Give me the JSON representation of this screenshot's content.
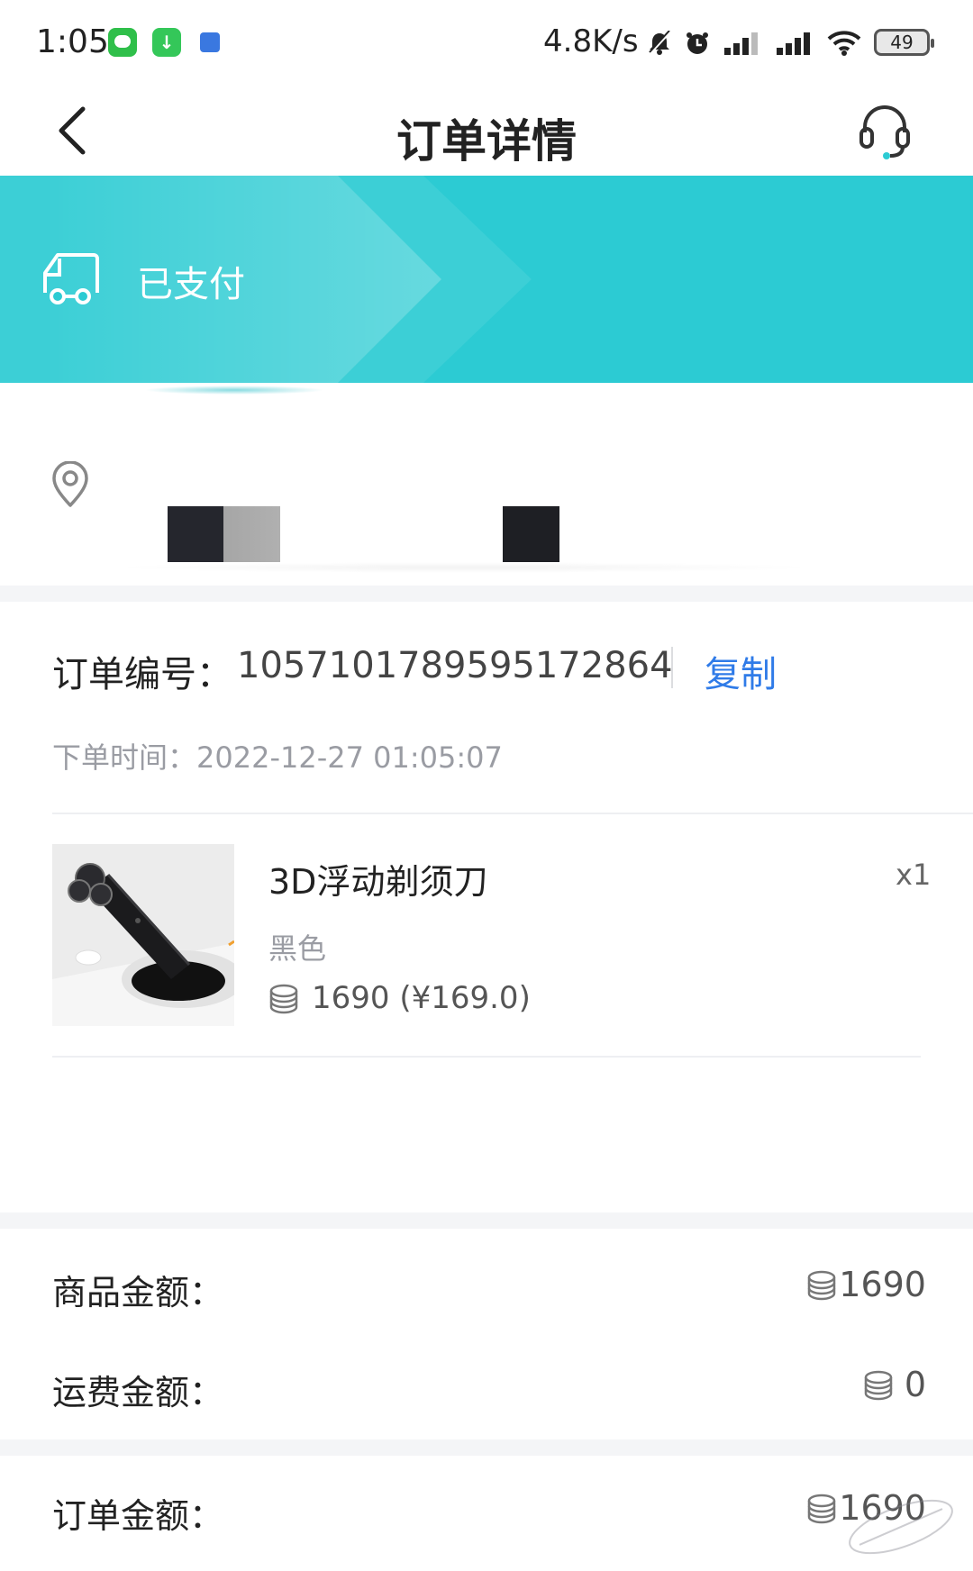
{
  "status_bar": {
    "time": "1:05",
    "speed": "4.8K/s",
    "battery": "49",
    "icons": [
      "messages-app-icon",
      "download-app-icon",
      "calendar-app-icon",
      "muted-bell-icon",
      "alarm-icon",
      "signal-icon",
      "signal-icon",
      "wifi-icon",
      "battery-icon"
    ]
  },
  "nav": {
    "title": "订单详情",
    "back_icon": "chevron-left-icon",
    "service_icon": "headset-icon"
  },
  "status_banner": {
    "text": "已支付",
    "icon": "truck-icon",
    "color": "#2ccbd3"
  },
  "address": {
    "icon": "location-pin-icon"
  },
  "order": {
    "number_label": "订单编号：",
    "number": "1057101789595172864",
    "copy_label": "复制",
    "time_label": "下单时间：",
    "time": "2022-12-27 01:05:07"
  },
  "product": {
    "name": "3D浮动剃须刀",
    "quantity": "x1",
    "variant": "黑色",
    "price": "1690 (¥169.0)"
  },
  "amounts": {
    "goods_label": "商品金额：",
    "goods_value": "1690",
    "shipping_label": "运费金额：",
    "shipping_value": "0",
    "order_label": "订单金额：",
    "order_value": "1690"
  },
  "colors": {
    "accent": "#2ccbd3",
    "link": "#2f7be8"
  }
}
